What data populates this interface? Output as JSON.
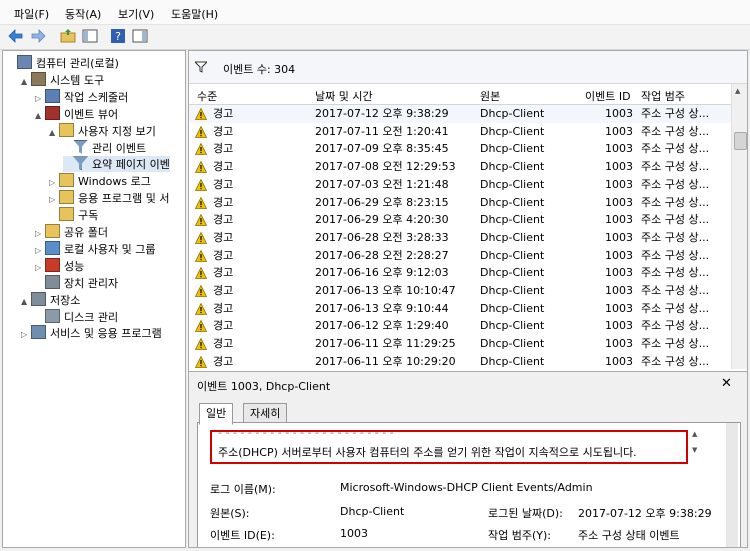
{
  "menu": [
    "파일(F)",
    "동작(A)",
    "보기(V)",
    "도움말(H)"
  ],
  "tree": [
    {
      "label": "컴퓨터 관리(로컬)",
      "indent": 0,
      "arrow": "",
      "icon": "computer-icon"
    },
    {
      "label": "시스템 도구",
      "indent": 1,
      "arrow": "▲",
      "icon": "tools-icon"
    },
    {
      "label": "작업 스케줄러",
      "indent": 2,
      "arrow": "▷",
      "icon": "clock-icon"
    },
    {
      "label": "이벤트 뷰어",
      "indent": 2,
      "arrow": "▲",
      "icon": "event-viewer-icon"
    },
    {
      "label": "사용자 지정 보기",
      "indent": 3,
      "arrow": "▲",
      "icon": "folder-icon"
    },
    {
      "label": "관리 이벤트",
      "indent": 4,
      "arrow": "",
      "icon": "filter-icon"
    },
    {
      "label": "요약 페이지 이벤",
      "indent": 4,
      "arrow": "",
      "icon": "filter-icon",
      "selected": true
    },
    {
      "label": "Windows 로그",
      "indent": 3,
      "arrow": "▷",
      "icon": "folder-icon"
    },
    {
      "label": "응용 프로그램 및 서",
      "indent": 3,
      "arrow": "▷",
      "icon": "folder-icon"
    },
    {
      "label": "구독",
      "indent": 3,
      "arrow": "",
      "icon": "subscription-icon"
    },
    {
      "label": "공유 폴더",
      "indent": 2,
      "arrow": "▷",
      "icon": "shared-folder-icon"
    },
    {
      "label": "로컬 사용자 및 그룹",
      "indent": 2,
      "arrow": "▷",
      "icon": "users-icon"
    },
    {
      "label": "성능",
      "indent": 2,
      "arrow": "▷",
      "icon": "performance-icon"
    },
    {
      "label": "장치 관리자",
      "indent": 2,
      "arrow": "",
      "icon": "device-manager-icon"
    },
    {
      "label": "저장소",
      "indent": 1,
      "arrow": "▲",
      "icon": "storage-icon"
    },
    {
      "label": "디스크 관리",
      "indent": 2,
      "arrow": "",
      "icon": "disk-icon"
    },
    {
      "label": "서비스 및 응용 프로그램",
      "indent": 1,
      "arrow": "▷",
      "icon": "services-icon"
    }
  ],
  "summary": {
    "label": "이벤트 수: 304"
  },
  "columns": [
    "수준",
    "날짜 및 시간",
    "원본",
    "이벤트 ID",
    "작업 범주"
  ],
  "events": [
    {
      "level": "경고",
      "datetime": "2017-07-12 오후 9:38:29",
      "source": "Dhcp-Client",
      "id": "1003",
      "category": "주소 구성 상..."
    },
    {
      "level": "경고",
      "datetime": "2017-07-11 오전 1:20:41",
      "source": "Dhcp-Client",
      "id": "1003",
      "category": "주소 구성 상..."
    },
    {
      "level": "경고",
      "datetime": "2017-07-09 오후 8:35:45",
      "source": "Dhcp-Client",
      "id": "1003",
      "category": "주소 구성 상..."
    },
    {
      "level": "경고",
      "datetime": "2017-07-08 오전 12:29:53",
      "source": "Dhcp-Client",
      "id": "1003",
      "category": "주소 구성 상..."
    },
    {
      "level": "경고",
      "datetime": "2017-07-03 오전 1:21:48",
      "source": "Dhcp-Client",
      "id": "1003",
      "category": "주소 구성 상..."
    },
    {
      "level": "경고",
      "datetime": "2017-06-29 오후 8:23:15",
      "source": "Dhcp-Client",
      "id": "1003",
      "category": "주소 구성 상..."
    },
    {
      "level": "경고",
      "datetime": "2017-06-29 오후 4:20:30",
      "source": "Dhcp-Client",
      "id": "1003",
      "category": "주소 구성 상..."
    },
    {
      "level": "경고",
      "datetime": "2017-06-28 오전 3:28:33",
      "source": "Dhcp-Client",
      "id": "1003",
      "category": "주소 구성 상..."
    },
    {
      "level": "경고",
      "datetime": "2017-06-28 오전 2:28:27",
      "source": "Dhcp-Client",
      "id": "1003",
      "category": "주소 구성 상..."
    },
    {
      "level": "경고",
      "datetime": "2017-06-16 오후 9:12:03",
      "source": "Dhcp-Client",
      "id": "1003",
      "category": "주소 구성 상..."
    },
    {
      "level": "경고",
      "datetime": "2017-06-13 오후 10:10:47",
      "source": "Dhcp-Client",
      "id": "1003",
      "category": "주소 구성 상..."
    },
    {
      "level": "경고",
      "datetime": "2017-06-13 오후 9:10:44",
      "source": "Dhcp-Client",
      "id": "1003",
      "category": "주소 구성 상..."
    },
    {
      "level": "경고",
      "datetime": "2017-06-12 오후 1:29:40",
      "source": "Dhcp-Client",
      "id": "1003",
      "category": "주소 구성 상..."
    },
    {
      "level": "경고",
      "datetime": "2017-06-11 오후 11:29:25",
      "source": "Dhcp-Client",
      "id": "1003",
      "category": "주소 구성 상..."
    },
    {
      "level": "경고",
      "datetime": "2017-06-11 오후 10:29:20",
      "source": "Dhcp-Client",
      "id": "1003",
      "category": "주소 구성 상..."
    }
  ],
  "detail": {
    "title": "이벤트 1003, Dhcp-Client",
    "tabs": [
      "일반",
      "자세히"
    ],
    "description": "주소(DHCP) 서버로부터 사용자 컴퓨터의 주소를 얻기 위한 작업이 지속적으로 시도됩니다.",
    "props": {
      "log_name_label": "로그 이름(M):",
      "log_name_value": "Microsoft-Windows-DHCP Client Events/Admin",
      "source_label": "원본(S):",
      "source_value": "Dhcp-Client",
      "logged_label": "로그된 날짜(D):",
      "logged_value": "2017-07-12 오후 9:38:29",
      "event_id_label": "이벤트 ID(E):",
      "event_id_value": "1003",
      "category_label": "작업 범주(Y):",
      "category_value": "주소 구성 상태 이벤트"
    }
  },
  "colors": {
    "warning": "#f2c200",
    "highlight": "#d40000",
    "selection": "#dde8f5"
  }
}
